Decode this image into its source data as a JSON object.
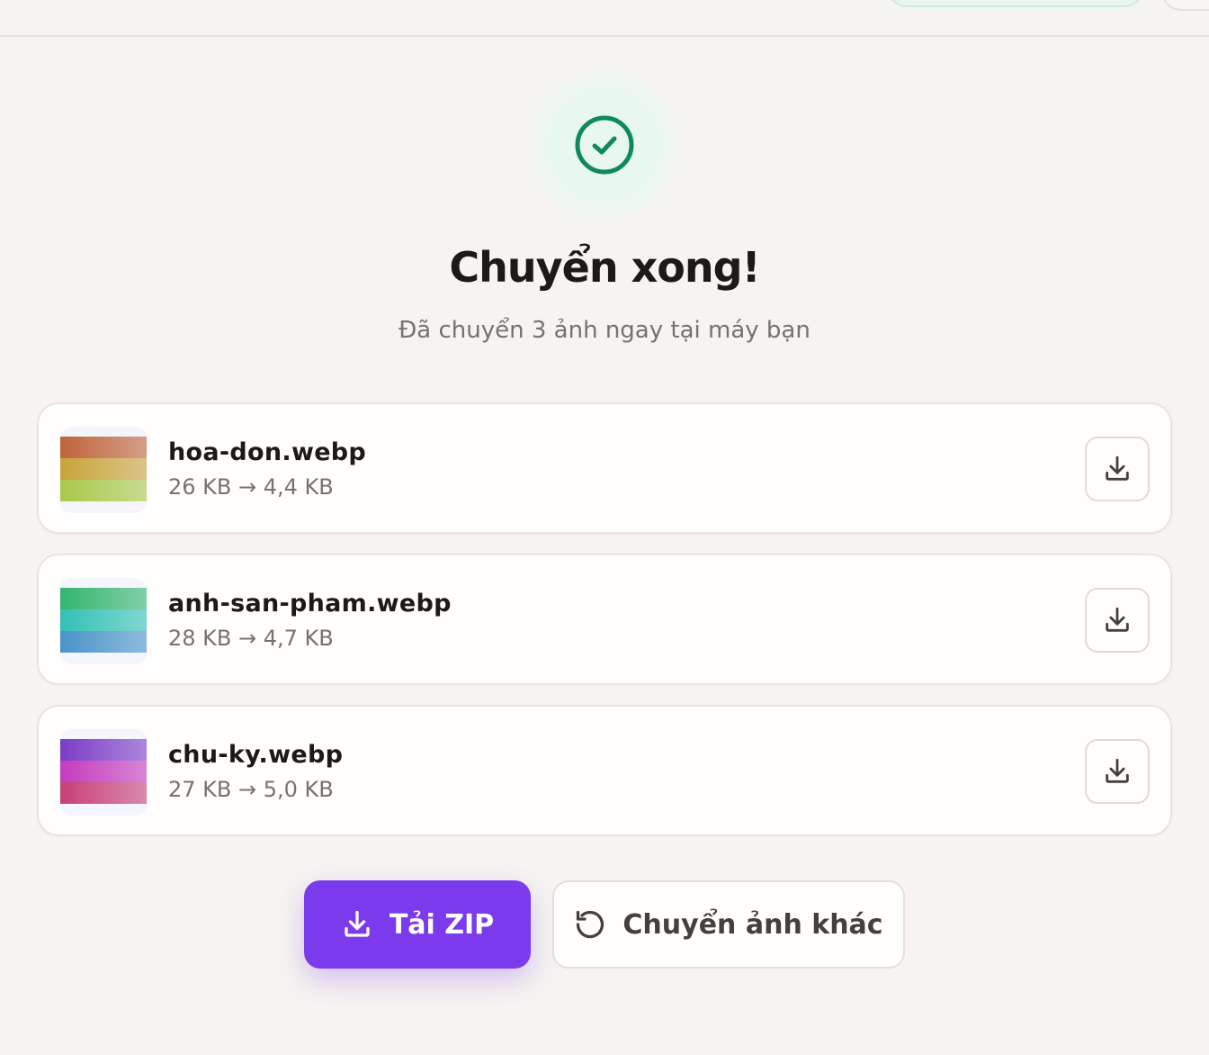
{
  "result": {
    "title": "Chuyển xong!",
    "subtitle": "Đã chuyển 3 ảnh ngay tại máy bạn"
  },
  "files": [
    {
      "name": "hoa-don.webp",
      "size": "26 KB → 4,4 KB",
      "thumb_colors": [
        "#c0643a",
        "#c8a43a",
        "#a9c94a"
      ]
    },
    {
      "name": "anh-san-pham.webp",
      "size": "28 KB → 4,7 KB",
      "thumb_colors": [
        "#35b56f",
        "#33c1b5",
        "#4a93c9"
      ]
    },
    {
      "name": "chu-ky.webp",
      "size": "27 KB → 5,0 KB",
      "thumb_colors": [
        "#7b3cc7",
        "#c43bbd",
        "#c84076"
      ]
    }
  ],
  "actions": {
    "zip_label": "Tải ZIP",
    "again_label": "Chuyển ảnh khác"
  },
  "icons": {
    "success": "check-circle-icon",
    "download": "download-icon",
    "restart": "rotate-ccw-icon"
  },
  "colors": {
    "accent": "#7c3aed",
    "success": "#0f8a5f"
  }
}
